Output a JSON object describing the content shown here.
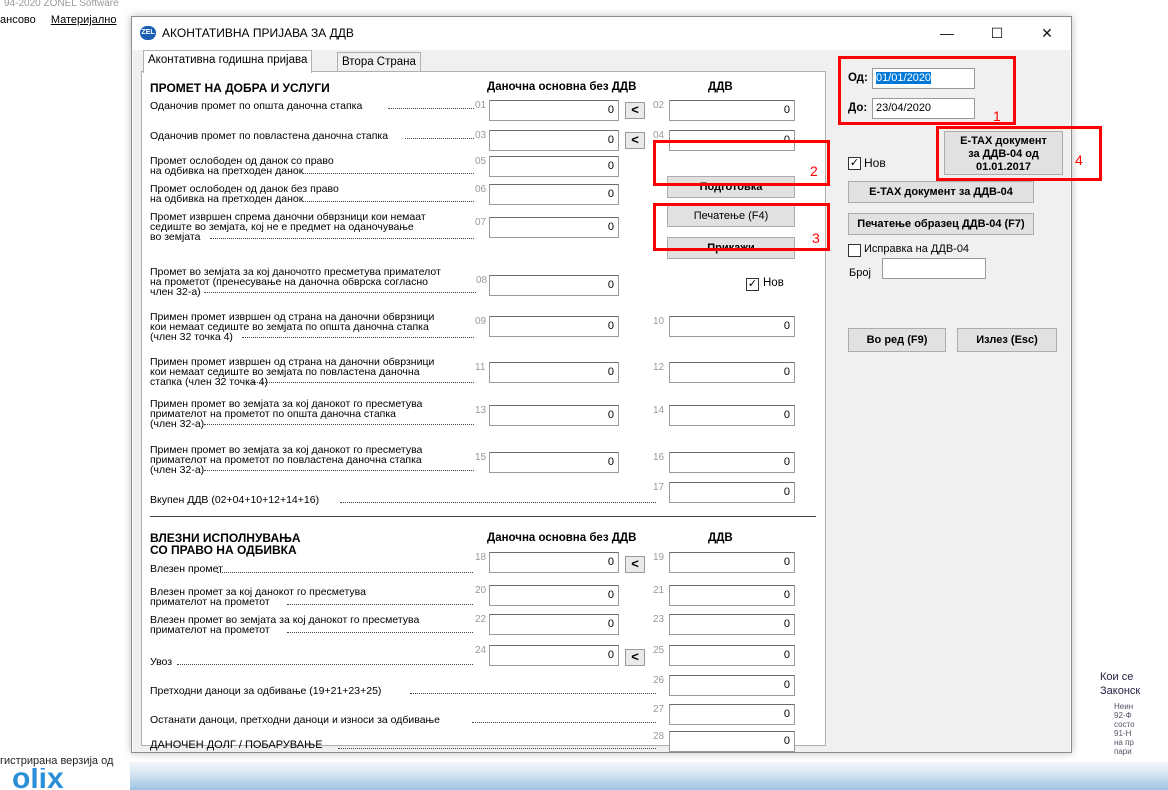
{
  "background": {
    "title_fragment": "94-2020  ZONEL Software",
    "menu": [
      "ансово",
      "Материјално"
    ],
    "status_left": "гистрирана верзија од",
    "logo_fragment": "olix",
    "right_text": [
      "Кои се",
      "Законск"
    ],
    "right_small": [
      "Неин",
      "92-Ф",
      "состо",
      "91-Н",
      "на пр",
      "пари"
    ]
  },
  "window": {
    "icon_label": "ZEL",
    "title": "АКОНТАТИВНА ПРИЈАВА ЗА ДДВ",
    "controls": {
      "minimize": "—",
      "maximize": "☐",
      "close": "✕"
    }
  },
  "tabs": [
    {
      "label": "Аконтативна годишна пријава",
      "active": true
    },
    {
      "label": "Втора Страна",
      "active": false
    }
  ],
  "section1": {
    "heading": "ПРОМЕТ НА ДОБРА И УСЛУГИ",
    "col_base": "Даночна основна без ДДВ",
    "col_vat": "ДДВ",
    "rows": [
      {
        "label": "Оданочив промет по општа даночна стапка",
        "n1": "01",
        "v1": "0",
        "arrow": "<",
        "n2": "02",
        "v2": "0"
      },
      {
        "label": "Оданочив промет по повластена даночна стапка",
        "n1": "03",
        "v1": "0",
        "arrow": "<",
        "n2": "04",
        "v2": "0"
      },
      {
        "label": "Промет ослободен од данок со право\nна одбивка на претходен данок",
        "n1": "05",
        "v1": "0"
      },
      {
        "label": "Промет ослободен од данок без право\nна одбивка на претходен данок",
        "n1": "06",
        "v1": "0"
      },
      {
        "label": "Промет извршен спрема даночни обврзници кои немаат\nседиште во земјата, кој не е предмет на оданочување\nво земјата",
        "n1": "07",
        "v1": "0"
      },
      {
        "label": "Промет во земјата за кој даночотго пресметува примателот\nна прометот (пренесување на даночна обврска согласно\nчлен 32-а)",
        "n1": "08",
        "v1": "0"
      },
      {
        "label": "Примен промет извршен од страна на даночни обврзници\nкои немаат седиште во земјата по општа даночна стапка\n(член 32 точка 4)",
        "n1": "09",
        "v1": "0",
        "n2": "10",
        "v2": "0"
      },
      {
        "label": "Примен промет извршен од страна на даночни обврзници\nкои немаат седиште во земјата по повластена даночна\nстапка (член 32 точка 4)",
        "n1": "11",
        "v1": "0",
        "n2": "12",
        "v2": "0"
      },
      {
        "label": "Примен промет во земјата за кој данокот го пресметува\nпримателот на прометот по општа даночна стапка\n(член 32-а)",
        "n1": "13",
        "v1": "0",
        "n2": "14",
        "v2": "0"
      },
      {
        "label": "Примен промет во земјата за кој данокот го пресметува\nпримателот на прометот по повластена даночна стапка\n(член 32-а)",
        "n1": "15",
        "v1": "0",
        "n2": "16",
        "v2": "0"
      },
      {
        "label": "Вкупен ДДВ (02+04+10+12+14+16)",
        "n2": "17",
        "v2": "0"
      }
    ],
    "buttons": {
      "prepare": "Подготовка",
      "print": "Печатење (F4)",
      "show": "Прикажи"
    },
    "new_checkbox": {
      "label": "Нов",
      "checked": true,
      "mark": "✓"
    }
  },
  "section2": {
    "heading": "ВЛЕЗНИ ИСПОЛНУВАЊА\nСО ПРАВО НА ОДБИВКА",
    "col_base": "Даночна основна без ДДВ",
    "col_vat": "ДДВ",
    "rows": [
      {
        "label": "Влезен промет",
        "n1": "18",
        "v1": "0",
        "arrow": "<",
        "n2": "19",
        "v2": "0"
      },
      {
        "label": "Влезен промет за кој данокот го пресметува\nпримателот на прометот",
        "n1": "20",
        "v1": "0",
        "n2": "21",
        "v2": "0"
      },
      {
        "label": "Влезен промет во земјата за кој данокот го пресметува\nпримателот на прометот",
        "n1": "22",
        "v1": "0",
        "n2": "23",
        "v2": "0"
      },
      {
        "label": "Увоз",
        "n1": "24",
        "v1": "0",
        "arrow": "<",
        "n2": "25",
        "v2": "0"
      },
      {
        "label": "Претходни даноци за одбивање (19+21+23+25)",
        "n2": "26",
        "v2": "0"
      },
      {
        "label": "Останати даноци, претходни даноци и износи за одбивање",
        "n2": "27",
        "v2": "0"
      },
      {
        "label": "ДАНОЧЕН ДОЛГ / ПОБАРУВАЊЕ",
        "n2": "28",
        "v2": "0"
      }
    ]
  },
  "right": {
    "from_label": "Од:",
    "from_value": "01/01/2020",
    "to_label": "До:",
    "to_value": "23/04/2020",
    "etax_2017": "E-TAX документ\nза ДДВ-04 од\n01.01.2017",
    "new_label": "Нов",
    "new_mark": "✓",
    "etax": "E-TAX документ за ДДВ-04",
    "print_form": "Печатење образец ДДВ-04 (F7)",
    "correction_label": "Исправка на ДДВ-04",
    "number_label": "Број",
    "number_value": "",
    "ok": "Во ред (F9)",
    "exit": "Излез (Esc)"
  },
  "annotations": [
    "1",
    "2",
    "3",
    "4"
  ],
  "colors": {
    "highlight": "#ff0000",
    "selection": "#0078d7"
  }
}
